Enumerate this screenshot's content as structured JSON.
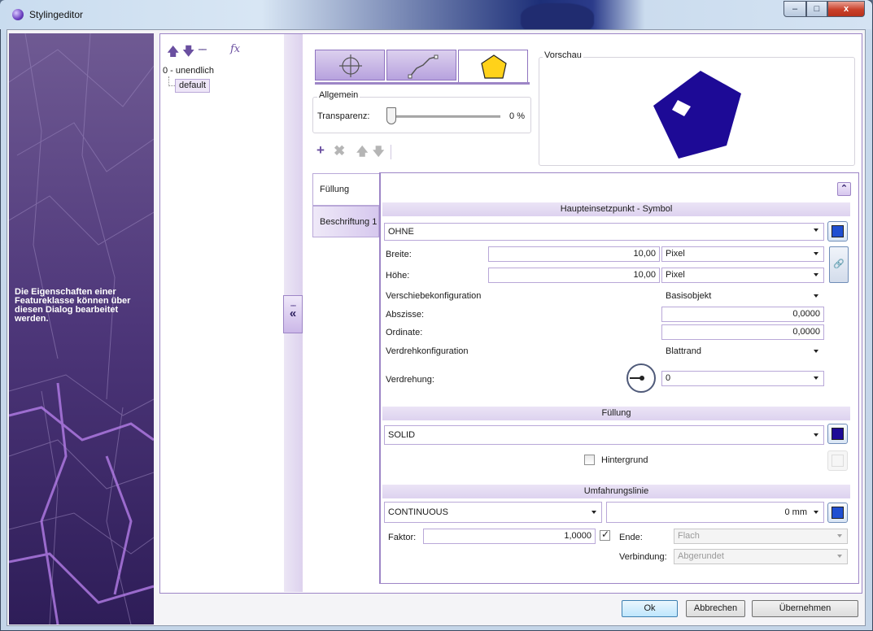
{
  "window": {
    "title": "Stylingeditor",
    "controls": {
      "minimize": "–",
      "maximize": "□",
      "close": "x"
    }
  },
  "banner": {
    "text": "Die Eigenschaften einer Featureklasse können über diesen Dialog bearbeitet werden."
  },
  "tree": {
    "toolbar": [
      "arrow-up-icon",
      "arrow-down-icon",
      "scale-range-icon",
      "fx-icon"
    ],
    "fx_label": "fx",
    "root_label": "0 - unendlich",
    "child_label": "default"
  },
  "geometry_tabs": [
    "point-tab",
    "line-tab",
    "polygon-tab"
  ],
  "general": {
    "title": "Allgemein",
    "transparency_label": "Transparenz:",
    "transparency_value": "0",
    "transparency_unit": "%",
    "transparency_fraction": 0
  },
  "preview": {
    "title": "Vorschau",
    "fill_color": "#1d0a96"
  },
  "style_toolbar": [
    "add-icon",
    "delete-icon",
    "move-up-icon",
    "move-down-icon"
  ],
  "side_tabs": [
    {
      "label": "Füllung",
      "active": true
    },
    {
      "label": "Beschriftung 1",
      "active": false
    }
  ],
  "insertion": {
    "header": "Haupteinsetzpunkt - Symbol",
    "symbol_value": "OHNE",
    "symbol_color": "#1f4fd1",
    "width_label": "Breite:",
    "width_value": "10,00",
    "width_unit": "Pixel",
    "height_label": "Höhe:",
    "height_value": "10,00",
    "height_unit": "Pixel",
    "offset_config_label": "Verschiebekonfiguration",
    "offset_config_value": "Basisobjekt",
    "abscissa_label": "Abszisse:",
    "abscissa_value": "0,0000",
    "ordinate_label": "Ordinate:",
    "ordinate_value": "0,0000",
    "rotation_config_label": "Verdrehkonfiguration",
    "rotation_config_value": "Blattrand",
    "rotation_label": "Verdrehung:",
    "rotation_value": "0"
  },
  "fill": {
    "header": "Füllung",
    "pattern_value": "SOLID",
    "color": "#1d0a96",
    "background_label": "Hintergrund",
    "background_checked": false
  },
  "outline": {
    "header": "Umfahrungslinie",
    "line_type_value": "CONTINUOUS",
    "width_value": "0 mm",
    "color": "#1f4fd1",
    "factor_label": "Faktor:",
    "factor_value": "1,0000",
    "factor_checked": true,
    "end_label": "Ende:",
    "end_value": "Flach",
    "join_label": "Verbindung:",
    "join_value": "Abgerundet"
  },
  "buttons": {
    "ok": "Ok",
    "cancel": "Abbrechen",
    "apply": "Übernehmen"
  }
}
